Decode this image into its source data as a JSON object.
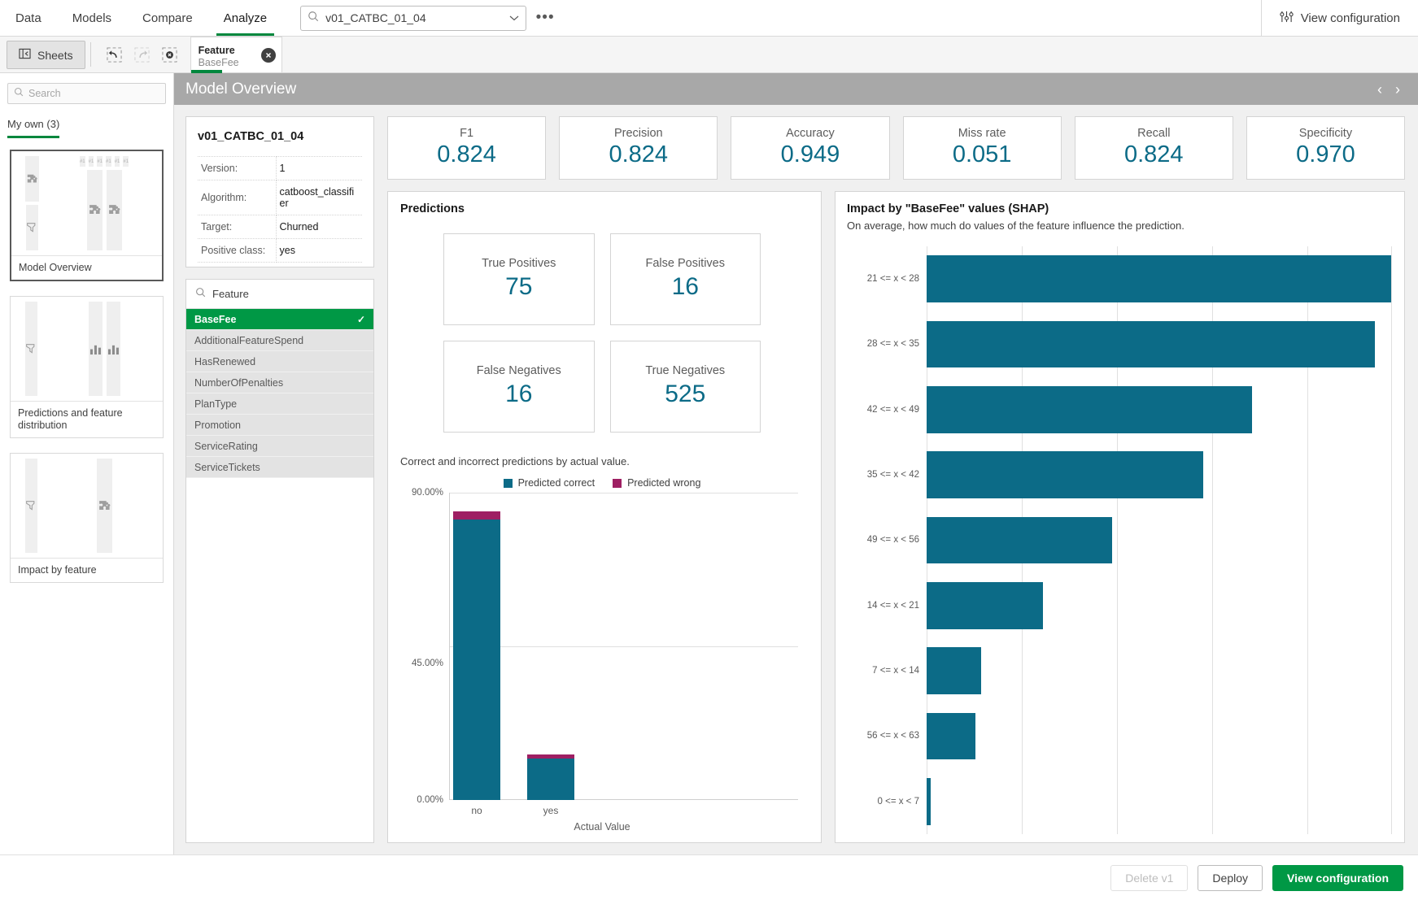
{
  "topnav": {
    "tabs": [
      {
        "label": "Data",
        "active": false
      },
      {
        "label": "Models",
        "active": false
      },
      {
        "label": "Compare",
        "active": false
      },
      {
        "label": "Analyze",
        "active": true
      }
    ],
    "search_value": "v01_CATBC_01_04",
    "more_label": "•••",
    "view_configuration_label": "View configuration"
  },
  "toolbar": {
    "sheets_label": "Sheets",
    "selection_chip": {
      "title": "Feature",
      "value": "BaseFee",
      "clear_label": "✕"
    }
  },
  "leftpanel": {
    "search_placeholder": "Search",
    "tab_label": "My own (3)",
    "sheets": [
      {
        "label": "Model Overview",
        "selected": true
      },
      {
        "label": "Predictions and feature distribution",
        "selected": false
      },
      {
        "label": "Impact by feature",
        "selected": false
      }
    ]
  },
  "sheet": {
    "title": "Model Overview",
    "prev_label": "‹",
    "next_label": "›"
  },
  "model_info": {
    "name": "v01_CATBC_01_04",
    "rows": [
      {
        "key": "Version:",
        "value": "1"
      },
      {
        "key": "Algorithm:",
        "value": "catboost_classifier"
      },
      {
        "key": "Target:",
        "value": "Churned"
      },
      {
        "key": "Positive class:",
        "value": "yes"
      }
    ]
  },
  "feature_list": {
    "header": "Feature",
    "items": [
      {
        "label": "BaseFee",
        "selected": true
      },
      {
        "label": "AdditionalFeatureSpend",
        "selected": false
      },
      {
        "label": "HasRenewed",
        "selected": false
      },
      {
        "label": "NumberOfPenalties",
        "selected": false
      },
      {
        "label": "PlanType",
        "selected": false
      },
      {
        "label": "Promotion",
        "selected": false
      },
      {
        "label": "ServiceRating",
        "selected": false
      },
      {
        "label": "ServiceTickets",
        "selected": false
      }
    ],
    "check_glyph": "✓"
  },
  "kpis": [
    {
      "label": "F1",
      "value": "0.824"
    },
    {
      "label": "Precision",
      "value": "0.824"
    },
    {
      "label": "Accuracy",
      "value": "0.949"
    },
    {
      "label": "Miss rate",
      "value": "0.051"
    },
    {
      "label": "Recall",
      "value": "0.824"
    },
    {
      "label": "Specificity",
      "value": "0.970"
    }
  ],
  "predictions": {
    "title": "Predictions",
    "confusion_matrix": [
      {
        "label": "True Positives",
        "value": "75"
      },
      {
        "label": "False Positives",
        "value": "16"
      },
      {
        "label": "False Negatives",
        "value": "16"
      },
      {
        "label": "True Negatives",
        "value": "525"
      }
    ],
    "subtitle": "Correct and incorrect predictions by actual value."
  },
  "shap": {
    "title": "Impact by \"BaseFee\" values (SHAP)",
    "subtitle": "On average, how much do values of the feature influence the prediction."
  },
  "footer": {
    "delete_label": "Delete v1",
    "deploy_label": "Deploy",
    "view_configuration_label": "View configuration"
  },
  "colors": {
    "accent_green": "#009845",
    "teal": "#0c6b87",
    "magenta": "#9e1f63",
    "sheet_header": "#a8a8a8"
  },
  "chart_data": [
    {
      "type": "bar",
      "id": "predictions-by-actual-value",
      "stacked": true,
      "title": "Correct and incorrect predictions by actual value.",
      "xlabel": "Actual Value",
      "ylabel": "",
      "categories": [
        "no",
        "yes"
      ],
      "series": [
        {
          "name": "Predicted correct",
          "color": "#0c6b87",
          "values": [
            82.1,
            11.7
          ]
        },
        {
          "name": "Predicted wrong",
          "color": "#9e1f63",
          "values": [
            2.5,
            1.3
          ]
        }
      ],
      "ylim": [
        0,
        90
      ],
      "yticks": [
        "0.00%",
        "45.00%",
        "90.00%"
      ],
      "ytick_values": [
        0,
        45,
        90
      ],
      "legend": [
        "Predicted correct",
        "Predicted wrong"
      ],
      "legend_position": "top",
      "grid": true
    },
    {
      "type": "bar",
      "id": "shap-impact-by-basefee",
      "orientation": "horizontal",
      "title": "Impact by \"BaseFee\" values (SHAP)",
      "subtitle": "On average, how much do values of the feature influence the prediction.",
      "xlabel": "",
      "ylabel": "",
      "categories": [
        "21 <= x < 28",
        "28 <= x < 35",
        "42 <= x < 49",
        "35 <= x < 42",
        "49 <= x < 56",
        "14 <= x < 21",
        "7 <= x < 14",
        "56 <= x < 63",
        "0 <= x < 7"
      ],
      "values": [
        100,
        96.5,
        70,
        59.5,
        40,
        25,
        11.8,
        10.5,
        0.8
      ],
      "bar_color": "#0c6b87",
      "grid": true,
      "gridline_positions_pct": [
        0,
        20.5,
        41,
        61.5,
        82,
        100
      ]
    }
  ]
}
